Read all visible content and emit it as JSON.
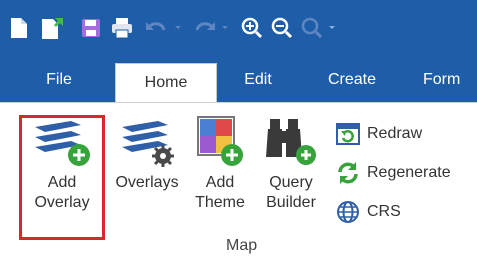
{
  "quick_access": [
    {
      "icon": "new-document-icon"
    },
    {
      "icon": "open-document-icon"
    },
    {
      "icon": "save-icon"
    },
    {
      "icon": "print-icon"
    },
    {
      "icon": "undo-icon"
    },
    {
      "icon": "redo-icon"
    },
    {
      "icon": "zoom-in-icon"
    },
    {
      "icon": "zoom-out-icon"
    },
    {
      "icon": "zoom-icon"
    }
  ],
  "tabs": [
    {
      "label": "File",
      "active": false
    },
    {
      "label": "Home",
      "active": true
    },
    {
      "label": "Edit",
      "active": false
    },
    {
      "label": "Create",
      "active": false
    },
    {
      "label": "Form",
      "active": false
    }
  ],
  "ribbon": {
    "group_label": "Map",
    "big_buttons": [
      {
        "label": "Add\nOverlay",
        "icon": "add-overlay-icon",
        "highlighted": true
      },
      {
        "label": "Overlays",
        "icon": "overlays-icon"
      },
      {
        "label": "Add\nTheme",
        "icon": "add-theme-icon"
      },
      {
        "label": "Query\nBuilder",
        "icon": "query-builder-icon"
      }
    ],
    "small_buttons": [
      {
        "label": "Redraw",
        "icon": "redraw-icon"
      },
      {
        "label": "Regenerate",
        "icon": "regenerate-icon"
      },
      {
        "label": "CRS",
        "icon": "globe-icon"
      }
    ]
  },
  "colors": {
    "titlebar": "#1e5ea8",
    "highlight_border": "#e02525",
    "icon_blue": "#2f5fa8",
    "icon_green": "#37a43b"
  }
}
